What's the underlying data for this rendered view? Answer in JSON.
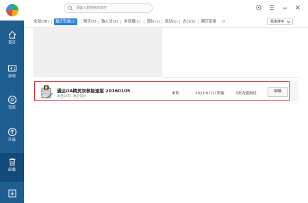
{
  "sidebar": {
    "items": [
      {
        "label": "首页",
        "icon": "home-icon"
      },
      {
        "label": "游戏",
        "icon": "gamepad-icon"
      },
      {
        "label": "宝库",
        "icon": "treasure-icon"
      },
      {
        "label": "升级",
        "icon": "upgrade-icon"
      },
      {
        "label": "卸载",
        "icon": "trash-icon"
      },
      {
        "label": "",
        "icon": "download-icon"
      }
    ]
  },
  "search": {
    "placeholder": "请输入想搜索的软件"
  },
  "tabs": [
    {
      "label": "全部(38)"
    },
    {
      "label": "最近安装(1)",
      "active": true
    },
    {
      "label": "聊天(5)"
    },
    {
      "label": "输入法(1)"
    },
    {
      "label": "浏览器(1)"
    },
    {
      "label": "图片(1)"
    },
    {
      "label": "驱动(1)"
    },
    {
      "label": "办公(1)"
    },
    {
      "label": "解压刻录"
    },
    {
      "label": "0"
    }
  ],
  "sort": {
    "label": "频率排序"
  },
  "app": {
    "name": "通达OA精灵双核极速版 20160105",
    "publisher": "出自公司: 通达信科",
    "size": "未知",
    "install_date": "2021/07/21安装",
    "usage": "3天内使用过",
    "uninstall_label": "卸载"
  },
  "colors": {
    "sidebar": "#1f5e8f",
    "accent": "#2d7fd2",
    "highlight": "#e0242b"
  }
}
